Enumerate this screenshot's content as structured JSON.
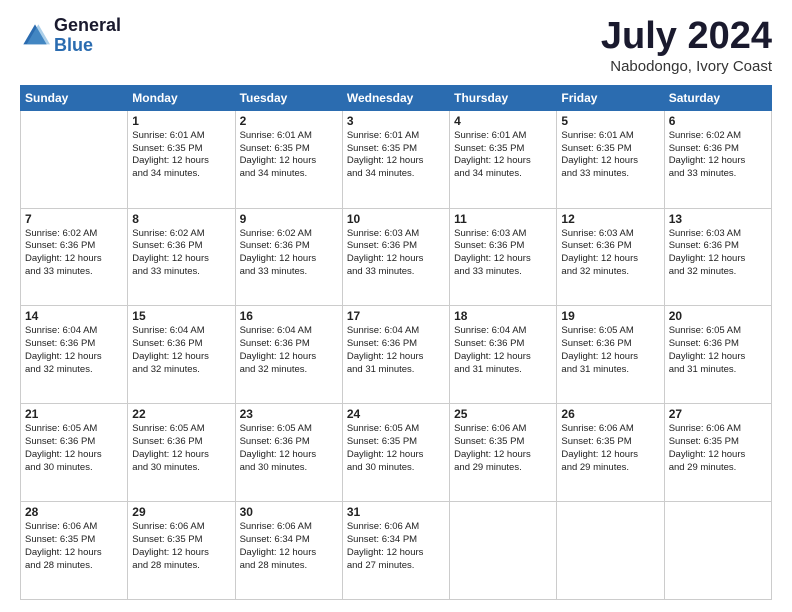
{
  "logo": {
    "line1": "General",
    "line2": "Blue"
  },
  "title": "July 2024",
  "location": "Nabodongo, Ivory Coast",
  "days_header": [
    "Sunday",
    "Monday",
    "Tuesday",
    "Wednesday",
    "Thursday",
    "Friday",
    "Saturday"
  ],
  "weeks": [
    [
      {
        "day": "",
        "info": ""
      },
      {
        "day": "1",
        "info": "Sunrise: 6:01 AM\nSunset: 6:35 PM\nDaylight: 12 hours\nand 34 minutes."
      },
      {
        "day": "2",
        "info": "Sunrise: 6:01 AM\nSunset: 6:35 PM\nDaylight: 12 hours\nand 34 minutes."
      },
      {
        "day": "3",
        "info": "Sunrise: 6:01 AM\nSunset: 6:35 PM\nDaylight: 12 hours\nand 34 minutes."
      },
      {
        "day": "4",
        "info": "Sunrise: 6:01 AM\nSunset: 6:35 PM\nDaylight: 12 hours\nand 34 minutes."
      },
      {
        "day": "5",
        "info": "Sunrise: 6:01 AM\nSunset: 6:35 PM\nDaylight: 12 hours\nand 33 minutes."
      },
      {
        "day": "6",
        "info": "Sunrise: 6:02 AM\nSunset: 6:36 PM\nDaylight: 12 hours\nand 33 minutes."
      }
    ],
    [
      {
        "day": "7",
        "info": "Sunrise: 6:02 AM\nSunset: 6:36 PM\nDaylight: 12 hours\nand 33 minutes."
      },
      {
        "day": "8",
        "info": "Sunrise: 6:02 AM\nSunset: 6:36 PM\nDaylight: 12 hours\nand 33 minutes."
      },
      {
        "day": "9",
        "info": "Sunrise: 6:02 AM\nSunset: 6:36 PM\nDaylight: 12 hours\nand 33 minutes."
      },
      {
        "day": "10",
        "info": "Sunrise: 6:03 AM\nSunset: 6:36 PM\nDaylight: 12 hours\nand 33 minutes."
      },
      {
        "day": "11",
        "info": "Sunrise: 6:03 AM\nSunset: 6:36 PM\nDaylight: 12 hours\nand 33 minutes."
      },
      {
        "day": "12",
        "info": "Sunrise: 6:03 AM\nSunset: 6:36 PM\nDaylight: 12 hours\nand 32 minutes."
      },
      {
        "day": "13",
        "info": "Sunrise: 6:03 AM\nSunset: 6:36 PM\nDaylight: 12 hours\nand 32 minutes."
      }
    ],
    [
      {
        "day": "14",
        "info": "Sunrise: 6:04 AM\nSunset: 6:36 PM\nDaylight: 12 hours\nand 32 minutes."
      },
      {
        "day": "15",
        "info": "Sunrise: 6:04 AM\nSunset: 6:36 PM\nDaylight: 12 hours\nand 32 minutes."
      },
      {
        "day": "16",
        "info": "Sunrise: 6:04 AM\nSunset: 6:36 PM\nDaylight: 12 hours\nand 32 minutes."
      },
      {
        "day": "17",
        "info": "Sunrise: 6:04 AM\nSunset: 6:36 PM\nDaylight: 12 hours\nand 31 minutes."
      },
      {
        "day": "18",
        "info": "Sunrise: 6:04 AM\nSunset: 6:36 PM\nDaylight: 12 hours\nand 31 minutes."
      },
      {
        "day": "19",
        "info": "Sunrise: 6:05 AM\nSunset: 6:36 PM\nDaylight: 12 hours\nand 31 minutes."
      },
      {
        "day": "20",
        "info": "Sunrise: 6:05 AM\nSunset: 6:36 PM\nDaylight: 12 hours\nand 31 minutes."
      }
    ],
    [
      {
        "day": "21",
        "info": "Sunrise: 6:05 AM\nSunset: 6:36 PM\nDaylight: 12 hours\nand 30 minutes."
      },
      {
        "day": "22",
        "info": "Sunrise: 6:05 AM\nSunset: 6:36 PM\nDaylight: 12 hours\nand 30 minutes."
      },
      {
        "day": "23",
        "info": "Sunrise: 6:05 AM\nSunset: 6:36 PM\nDaylight: 12 hours\nand 30 minutes."
      },
      {
        "day": "24",
        "info": "Sunrise: 6:05 AM\nSunset: 6:35 PM\nDaylight: 12 hours\nand 30 minutes."
      },
      {
        "day": "25",
        "info": "Sunrise: 6:06 AM\nSunset: 6:35 PM\nDaylight: 12 hours\nand 29 minutes."
      },
      {
        "day": "26",
        "info": "Sunrise: 6:06 AM\nSunset: 6:35 PM\nDaylight: 12 hours\nand 29 minutes."
      },
      {
        "day": "27",
        "info": "Sunrise: 6:06 AM\nSunset: 6:35 PM\nDaylight: 12 hours\nand 29 minutes."
      }
    ],
    [
      {
        "day": "28",
        "info": "Sunrise: 6:06 AM\nSunset: 6:35 PM\nDaylight: 12 hours\nand 28 minutes."
      },
      {
        "day": "29",
        "info": "Sunrise: 6:06 AM\nSunset: 6:35 PM\nDaylight: 12 hours\nand 28 minutes."
      },
      {
        "day": "30",
        "info": "Sunrise: 6:06 AM\nSunset: 6:34 PM\nDaylight: 12 hours\nand 28 minutes."
      },
      {
        "day": "31",
        "info": "Sunrise: 6:06 AM\nSunset: 6:34 PM\nDaylight: 12 hours\nand 27 minutes."
      },
      {
        "day": "",
        "info": ""
      },
      {
        "day": "",
        "info": ""
      },
      {
        "day": "",
        "info": ""
      }
    ]
  ]
}
